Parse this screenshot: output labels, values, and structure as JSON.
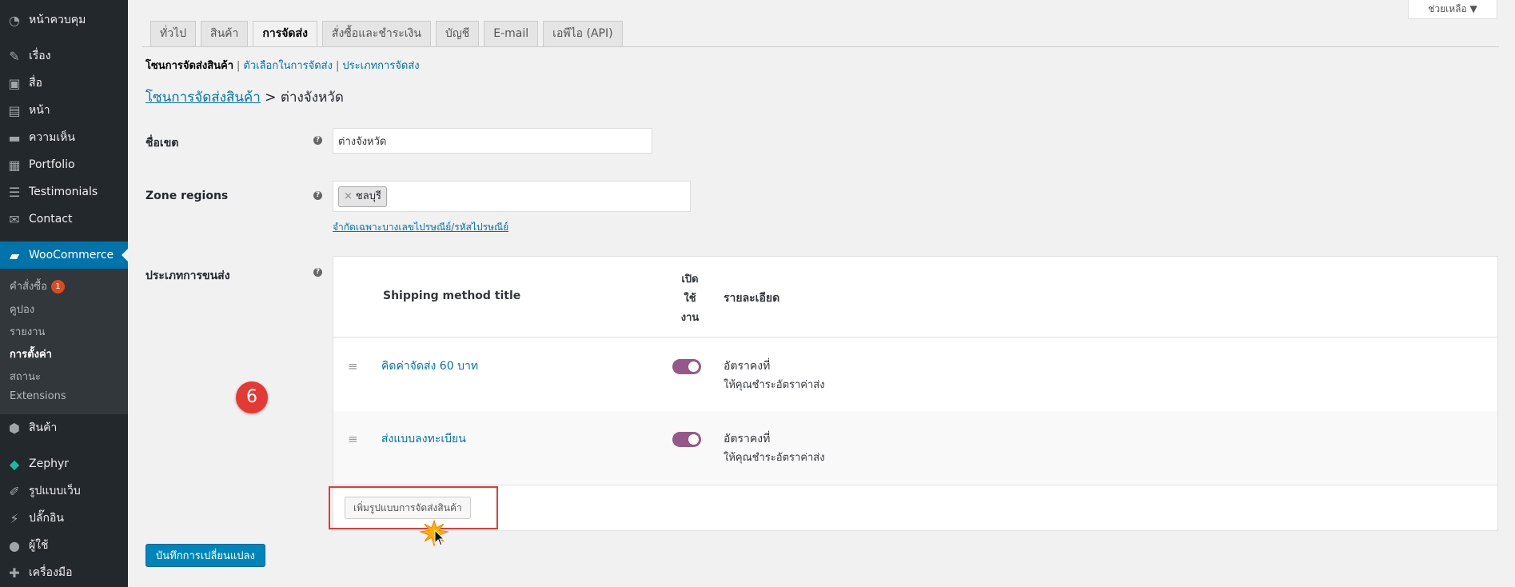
{
  "sidebar": {
    "items": [
      {
        "label": "หน้าควบคุม",
        "icon": "dashboard-icon"
      },
      {
        "label": "เรื่อง",
        "icon": "pin-icon"
      },
      {
        "label": "สื่อ",
        "icon": "media-icon"
      },
      {
        "label": "หน้า",
        "icon": "page-icon"
      },
      {
        "label": "ความเห็น",
        "icon": "comment-icon"
      },
      {
        "label": "Portfolio",
        "icon": "portfolio-icon"
      },
      {
        "label": "Testimonials",
        "icon": "testimonial-icon"
      },
      {
        "label": "Contact",
        "icon": "mail-icon"
      },
      {
        "label": "WooCommerce",
        "icon": "woo-icon"
      },
      {
        "label": "สินค้า",
        "icon": "box-icon"
      },
      {
        "label": "Zephyr",
        "icon": "gem-icon"
      },
      {
        "label": "รูปแบบเว็บ",
        "icon": "brush-icon"
      },
      {
        "label": "ปลั๊กอิน",
        "icon": "plugin-icon"
      },
      {
        "label": "ผู้ใช้",
        "icon": "user-icon"
      },
      {
        "label": "เครื่องมือ",
        "icon": "wrench-icon"
      }
    ],
    "woo_submenu": [
      {
        "label": "คำสั่งซื้อ",
        "badge": "1"
      },
      {
        "label": "คูปอง"
      },
      {
        "label": "รายงาน"
      },
      {
        "label": "การตั้งค่า"
      },
      {
        "label": "สถานะ"
      },
      {
        "label": "Extensions"
      }
    ]
  },
  "help_tab": {
    "label": "ช่วยเหลือ ▼"
  },
  "tabs": [
    "ทั่วไป",
    "สินค้า",
    "การจัดส่ง",
    "สั่งซื้อและชำระเงิน",
    "บัญชี",
    "E-mail",
    "เอพีไอ (API)"
  ],
  "subsub": {
    "current": "โซนการจัดส่งสินค้า",
    "link1": "ตัวเลือกในการจัดส่ง",
    "link2": "ประเภทการจัดส่ง",
    "sep": "|"
  },
  "breadcrumb": {
    "link": "โซนการจัดส่งสินค้า",
    "arrow": ">",
    "current": "ต่างจังหวัด"
  },
  "form": {
    "zone_name_label": "ชื่อเขต",
    "zone_name_value": "ต่างจังหวัด",
    "zone_regions_label": "Zone regions",
    "region_token": "ชลบุรี",
    "region_token_remove": "×",
    "postcode_link": "จำกัดเฉพาะบางเลขไปรษณีย์/รหัสไปรษณีย์",
    "methods_label": "ประเภทการขนส่ง",
    "help_glyph": "?"
  },
  "methods_table": {
    "headers": {
      "title": "Shipping method title",
      "enabled_line1": "เปิด",
      "enabled_line2": "ใช้",
      "enabled_line3": "งาน",
      "description": "รายละเอียด"
    },
    "rows": [
      {
        "title": "คิดค่าจัดส่ง 60 บาท",
        "enabled": true,
        "desc_title": "อัตราคงที่",
        "desc_sub": "ให้คุณชำระอัตราค่าส่ง"
      },
      {
        "title": "ส่งแบบลงทะเบียน",
        "enabled": true,
        "desc_title": "อัตราคงที่",
        "desc_sub": "ให้คุณชำระอัตราค่าส่ง"
      }
    ],
    "add_button": "เพิ่มรูปแบบการจัดส่งสินค้า"
  },
  "annotation": {
    "step_number": "6",
    "highlight_color": "#e53935"
  },
  "save_button": "บันทึกการเปลี่ยนแปลง",
  "colors": {
    "accent": "#0073aa",
    "toggle": "#96588a",
    "sidebar": "#23282d",
    "save": "#0085ba"
  }
}
